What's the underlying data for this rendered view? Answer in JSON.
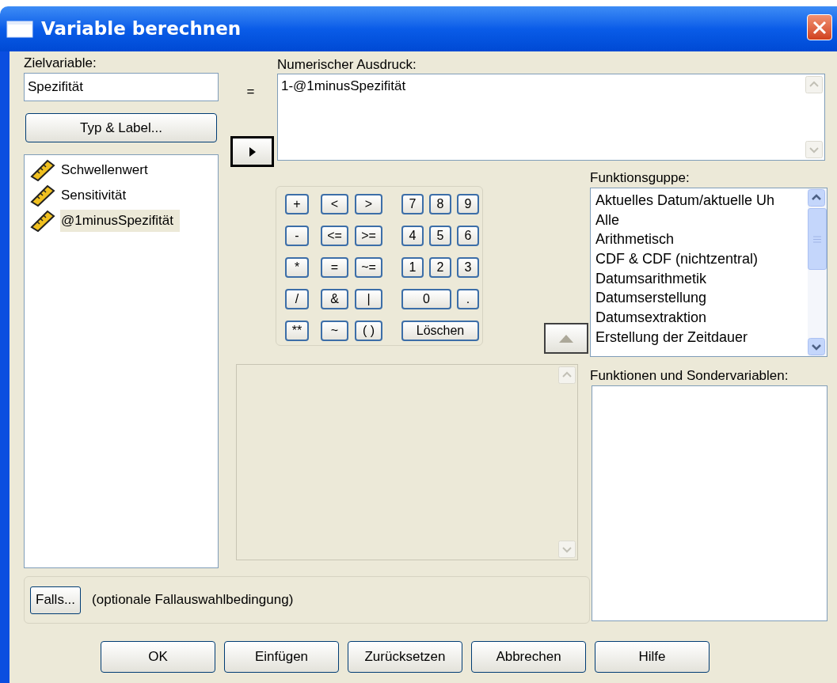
{
  "window": {
    "title": "Variable berechnen"
  },
  "target_variable": {
    "label": "Zielvariable:",
    "value": "Spezifität"
  },
  "equals": "=",
  "type_label_button": "Typ & Label...",
  "variables": [
    {
      "name": "Schwellenwert",
      "kind": "scale",
      "selected": false
    },
    {
      "name": "Sensitivität",
      "kind": "scale",
      "selected": false
    },
    {
      "name": "@1minusSpezifität",
      "kind": "scale",
      "selected": true
    }
  ],
  "expression": {
    "label": "Numerischer Ausdruck:",
    "value": "1-@1minusSpezifität"
  },
  "keypad": [
    {
      "ops": [
        {
          "label": "+"
        }
      ],
      "compare": [
        {
          "label": "<"
        },
        {
          "label": ">"
        }
      ],
      "digits": [
        {
          "label": "7",
          "kind": "key"
        },
        {
          "label": "8",
          "kind": "key"
        },
        {
          "label": "9",
          "kind": "key"
        }
      ]
    },
    {
      "ops": [
        {
          "label": "-"
        }
      ],
      "compare": [
        {
          "label": "<="
        },
        {
          "label": ">="
        }
      ],
      "digits": [
        {
          "label": "4",
          "kind": "key"
        },
        {
          "label": "5",
          "kind": "key"
        },
        {
          "label": "6",
          "kind": "key"
        }
      ]
    },
    {
      "ops": [
        {
          "label": "*"
        }
      ],
      "compare": [
        {
          "label": "="
        },
        {
          "label": "~="
        }
      ],
      "digits": [
        {
          "label": "1",
          "kind": "key"
        },
        {
          "label": "2",
          "kind": "key"
        },
        {
          "label": "3",
          "kind": "key"
        }
      ]
    },
    {
      "ops": [
        {
          "label": "/"
        }
      ],
      "compare": [
        {
          "label": "&"
        },
        {
          "label": "|"
        }
      ],
      "digits": [
        {
          "label": "0",
          "kind": "wide"
        },
        {
          "label": ".",
          "kind": "key"
        }
      ]
    },
    {
      "ops": [
        {
          "label": "**"
        }
      ],
      "compare": [
        {
          "label": "~"
        },
        {
          "label": "( )"
        }
      ],
      "digits": [
        {
          "label": "Löschen",
          "kind": "wide"
        }
      ]
    }
  ],
  "function_group": {
    "label": "Funktionsguppe:",
    "items": [
      {
        "name": "Aktuelles Datum/aktuelle Uh",
        "selected": false
      },
      {
        "name": "Alle",
        "selected": false
      },
      {
        "name": "Arithmetisch",
        "selected": false
      },
      {
        "name": "CDF & CDF (nichtzentral)",
        "selected": false
      },
      {
        "name": "Datumsarithmetik",
        "selected": false
      },
      {
        "name": "Datumserstellung",
        "selected": false
      },
      {
        "name": "Datumsextraktion",
        "selected": false
      },
      {
        "name": "Erstellung der Zeitdauer",
        "selected": false
      }
    ]
  },
  "functions": {
    "label": "Funktionen und Sondervariablen:"
  },
  "condition": {
    "button": "Falls...",
    "text": "(optionale Fallauswahlbedingung)"
  },
  "buttons": [
    "OK",
    "Einfügen",
    "Zurücksetzen",
    "Abbrechen",
    "Hilfe"
  ]
}
